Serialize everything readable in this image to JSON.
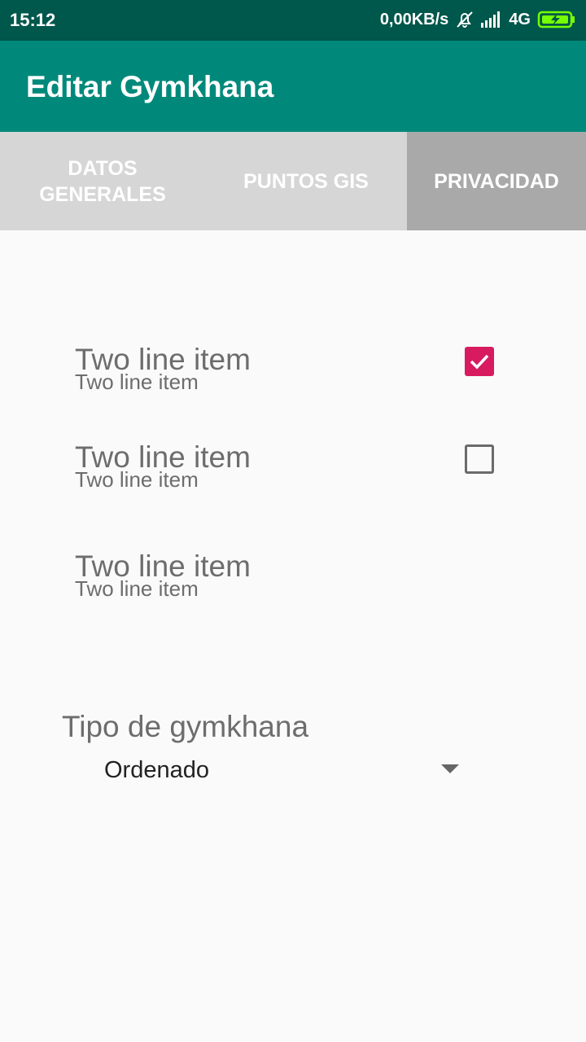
{
  "status_bar": {
    "time": "15:12",
    "network_speed": "0,00KB/s",
    "network_type": "4G",
    "icons": [
      "bell-off-icon",
      "signal-icon",
      "battery-charging-icon"
    ]
  },
  "app_bar": {
    "title": "Editar Gymkhana"
  },
  "tabs": [
    {
      "label": "DATOS\nGENERALES",
      "selected": false
    },
    {
      "label": "PUNTOS GIS",
      "selected": false
    },
    {
      "label": "PRIVACIDAD",
      "selected": true
    }
  ],
  "items": [
    {
      "primary": "Two line item",
      "secondary": "Two line item",
      "checkbox": "checked"
    },
    {
      "primary": "Two line item",
      "secondary": "Two line item",
      "checkbox": "unchecked"
    },
    {
      "primary": "Two line item",
      "secondary": "Two line item"
    }
  ],
  "gymkhana_type": {
    "label": "Tipo de gymkhana",
    "selected": "Ordenado"
  },
  "colors": {
    "status_bar": "#00574b",
    "app_bar": "#00897b",
    "accent": "#d81b60",
    "tab_selected": "#a9a9a9",
    "tab_bg": "#d6d6d6"
  }
}
